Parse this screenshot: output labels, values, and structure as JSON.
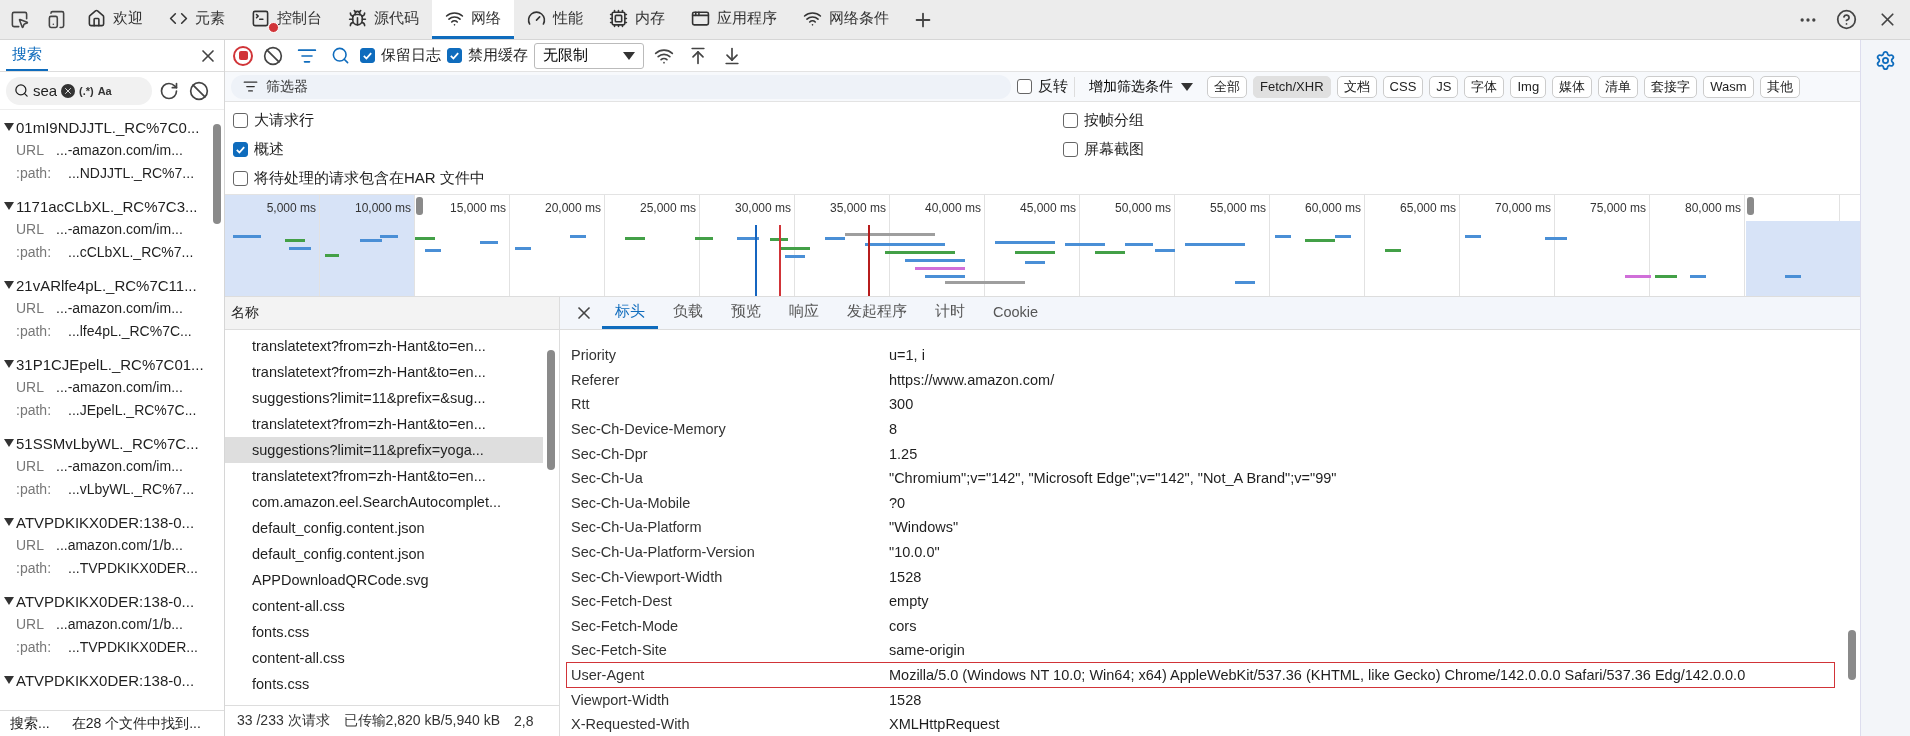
{
  "top_tabs": [
    {
      "label": "欢迎",
      "selected": false,
      "errors": false
    },
    {
      "label": "元素",
      "selected": false,
      "errors": false
    },
    {
      "label": "控制台",
      "selected": false,
      "errors": true
    },
    {
      "label": "源代码",
      "selected": false,
      "errors": false
    },
    {
      "label": "网络",
      "selected": true,
      "errors": false
    },
    {
      "label": "性能",
      "selected": false,
      "errors": false
    },
    {
      "label": "内存",
      "selected": false,
      "errors": false
    },
    {
      "label": "应用程序",
      "selected": false,
      "errors": false
    },
    {
      "label": "网络条件",
      "selected": false,
      "errors": false
    }
  ],
  "search_panel": {
    "tab": "搜索",
    "query": "sea",
    "regex": "(.*)",
    "case": "Aa",
    "results": [
      {
        "title": "01mI9NDJJTL._RC%7C0...",
        "url_label": "URL",
        "url": "...-amazon.com/im...",
        "path_label": ":path:",
        "path": "...NDJJTL._RC%7..."
      },
      {
        "title": "1171acCLbXL._RC%7C3...",
        "url_label": "URL",
        "url": "...-amazon.com/im...",
        "path_label": ":path:",
        "path": "...cCLbXL._RC%7..."
      },
      {
        "title": "21vARlfe4pL._RC%7C11...",
        "url_label": "URL",
        "url": "...-amazon.com/im...",
        "path_label": ":path:",
        "path": "...lfe4pL._RC%7C..."
      },
      {
        "title": "31P1CJEpelL._RC%7C01...",
        "url_label": "URL",
        "url": "...-amazon.com/im...",
        "path_label": ":path:",
        "path": "...JEpelL._RC%7C..."
      },
      {
        "title": "51SSMvLbyWL._RC%7C...",
        "url_label": "URL",
        "url": "...-amazon.com/im...",
        "path_label": ":path:",
        "path": "...vLbyWL._RC%7..."
      },
      {
        "title": "ATVPDKIKX0DER:138-0...",
        "url_label": "URL",
        "url": "...amazon.com/1/b...",
        "path_label": ":path:",
        "path": "...TVPDKIKX0DER..."
      },
      {
        "title": "ATVPDKIKX0DER:138-0...",
        "url_label": "URL",
        "url": "...amazon.com/1/b...",
        "path_label": ":path:",
        "path": "...TVPDKIKX0DER..."
      },
      {
        "title": "ATVPDKIKX0DER:138-0..."
      }
    ],
    "status": [
      "搜索...",
      "在28 个文件中找到..."
    ]
  },
  "toolbar": {
    "recording": true,
    "preserve_log": {
      "label": "保留日志",
      "checked": true
    },
    "disable_cache": {
      "label": "禁用缓存",
      "checked": true
    },
    "throttling": "无限制"
  },
  "filter": {
    "placeholder": "筛选器",
    "invert": {
      "label": "反转",
      "checked": false
    },
    "more_filters": "增加筛选条件",
    "types": [
      {
        "label": "全部",
        "selected": false
      },
      {
        "label": "Fetch/XHR",
        "selected": true
      },
      {
        "label": "文档",
        "selected": false
      },
      {
        "label": "CSS",
        "selected": false
      },
      {
        "label": "JS",
        "selected": false
      },
      {
        "label": "字体",
        "selected": false
      },
      {
        "label": "Img",
        "selected": false
      },
      {
        "label": "媒体",
        "selected": false
      },
      {
        "label": "清单",
        "selected": false
      },
      {
        "label": "套接字",
        "selected": false
      },
      {
        "label": "Wasm",
        "selected": false
      },
      {
        "label": "其他",
        "selected": false
      }
    ]
  },
  "options_left": [
    {
      "label": "大请求行",
      "checked": false
    },
    {
      "label": "概述",
      "checked": true
    },
    {
      "label": "将待处理的请求包含在HAR 文件中",
      "checked": false
    }
  ],
  "options_right": [
    {
      "label": "按帧分组",
      "checked": false
    },
    {
      "label": "屏幕截图",
      "checked": false
    }
  ],
  "timeline": {
    "ticks": [
      "5,000 ms",
      "10,000 ms",
      "15,000 ms",
      "20,000 ms",
      "25,000 ms",
      "30,000 ms",
      "35,000 ms",
      "40,000 ms",
      "45,000 ms",
      "50,000 ms",
      "55,000 ms",
      "60,000 ms",
      "65,000 ms",
      "70,000 ms",
      "75,000 ms",
      "80,000 ms"
    ]
  },
  "requests": {
    "column": "名称",
    "rows": [
      {
        "name": "translatetext?from=zh-Hant&to=en...",
        "selected": false
      },
      {
        "name": "translatetext?from=zh-Hant&to=en...",
        "selected": false
      },
      {
        "name": "suggestions?limit=11&prefix=&sug...",
        "selected": false
      },
      {
        "name": "translatetext?from=zh-Hant&to=en...",
        "selected": false
      },
      {
        "name": "suggestions?limit=11&prefix=yoga...",
        "selected": true
      },
      {
        "name": "translatetext?from=zh-Hant&to=en...",
        "selected": false
      },
      {
        "name": "com.amazon.eel.SearchAutocomplet...",
        "selected": false
      },
      {
        "name": "default_config.content.json",
        "selected": false
      },
      {
        "name": "default_config.content.json",
        "selected": false
      },
      {
        "name": "APPDownloadQRCode.svg",
        "selected": false
      },
      {
        "name": "content-all.css",
        "selected": false
      },
      {
        "name": "fonts.css",
        "selected": false
      },
      {
        "name": "content-all.css",
        "selected": false
      },
      {
        "name": "fonts.css",
        "selected": false
      }
    ],
    "status": [
      "33 /233 次请求",
      "已传输2,820 kB/5,940 kB",
      "2,8"
    ]
  },
  "details": {
    "tabs": [
      {
        "label": "标头",
        "selected": true
      },
      {
        "label": "负载",
        "selected": false
      },
      {
        "label": "预览",
        "selected": false
      },
      {
        "label": "响应",
        "selected": false
      },
      {
        "label": "发起程序",
        "selected": false
      },
      {
        "label": "计时",
        "selected": false
      },
      {
        "label": "Cookie",
        "selected": false
      }
    ],
    "headers": [
      {
        "name": "Priority",
        "value": "u=1, i",
        "highlighted": false
      },
      {
        "name": "Referer",
        "value": "https://www.amazon.com/",
        "highlighted": false
      },
      {
        "name": "Rtt",
        "value": "300",
        "highlighted": false
      },
      {
        "name": "Sec-Ch-Device-Memory",
        "value": "8",
        "highlighted": false
      },
      {
        "name": "Sec-Ch-Dpr",
        "value": "1.25",
        "highlighted": false
      },
      {
        "name": "Sec-Ch-Ua",
        "value": "\"Chromium\";v=\"142\", \"Microsoft Edge\";v=\"142\", \"Not_A Brand\";v=\"99\"",
        "highlighted": false
      },
      {
        "name": "Sec-Ch-Ua-Mobile",
        "value": "?0",
        "highlighted": false
      },
      {
        "name": "Sec-Ch-Ua-Platform",
        "value": "\"Windows\"",
        "highlighted": false
      },
      {
        "name": "Sec-Ch-Ua-Platform-Version",
        "value": "\"10.0.0\"",
        "highlighted": false
      },
      {
        "name": "Sec-Ch-Viewport-Width",
        "value": "1528",
        "highlighted": false
      },
      {
        "name": "Sec-Fetch-Dest",
        "value": "empty",
        "highlighted": false
      },
      {
        "name": "Sec-Fetch-Mode",
        "value": "cors",
        "highlighted": false
      },
      {
        "name": "Sec-Fetch-Site",
        "value": "same-origin",
        "highlighted": false
      },
      {
        "name": "User-Agent",
        "value": "Mozilla/5.0 (Windows NT 10.0; Win64; x64) AppleWebKit/537.36 (KHTML, like Gecko) Chrome/142.0.0.0 Safari/537.36 Edg/142.0.0.0",
        "highlighted": true
      },
      {
        "name": "Viewport-Width",
        "value": "1528",
        "highlighted": false
      },
      {
        "name": "X-Requested-With",
        "value": "XMLHttpRequest",
        "highlighted": false
      }
    ]
  }
}
